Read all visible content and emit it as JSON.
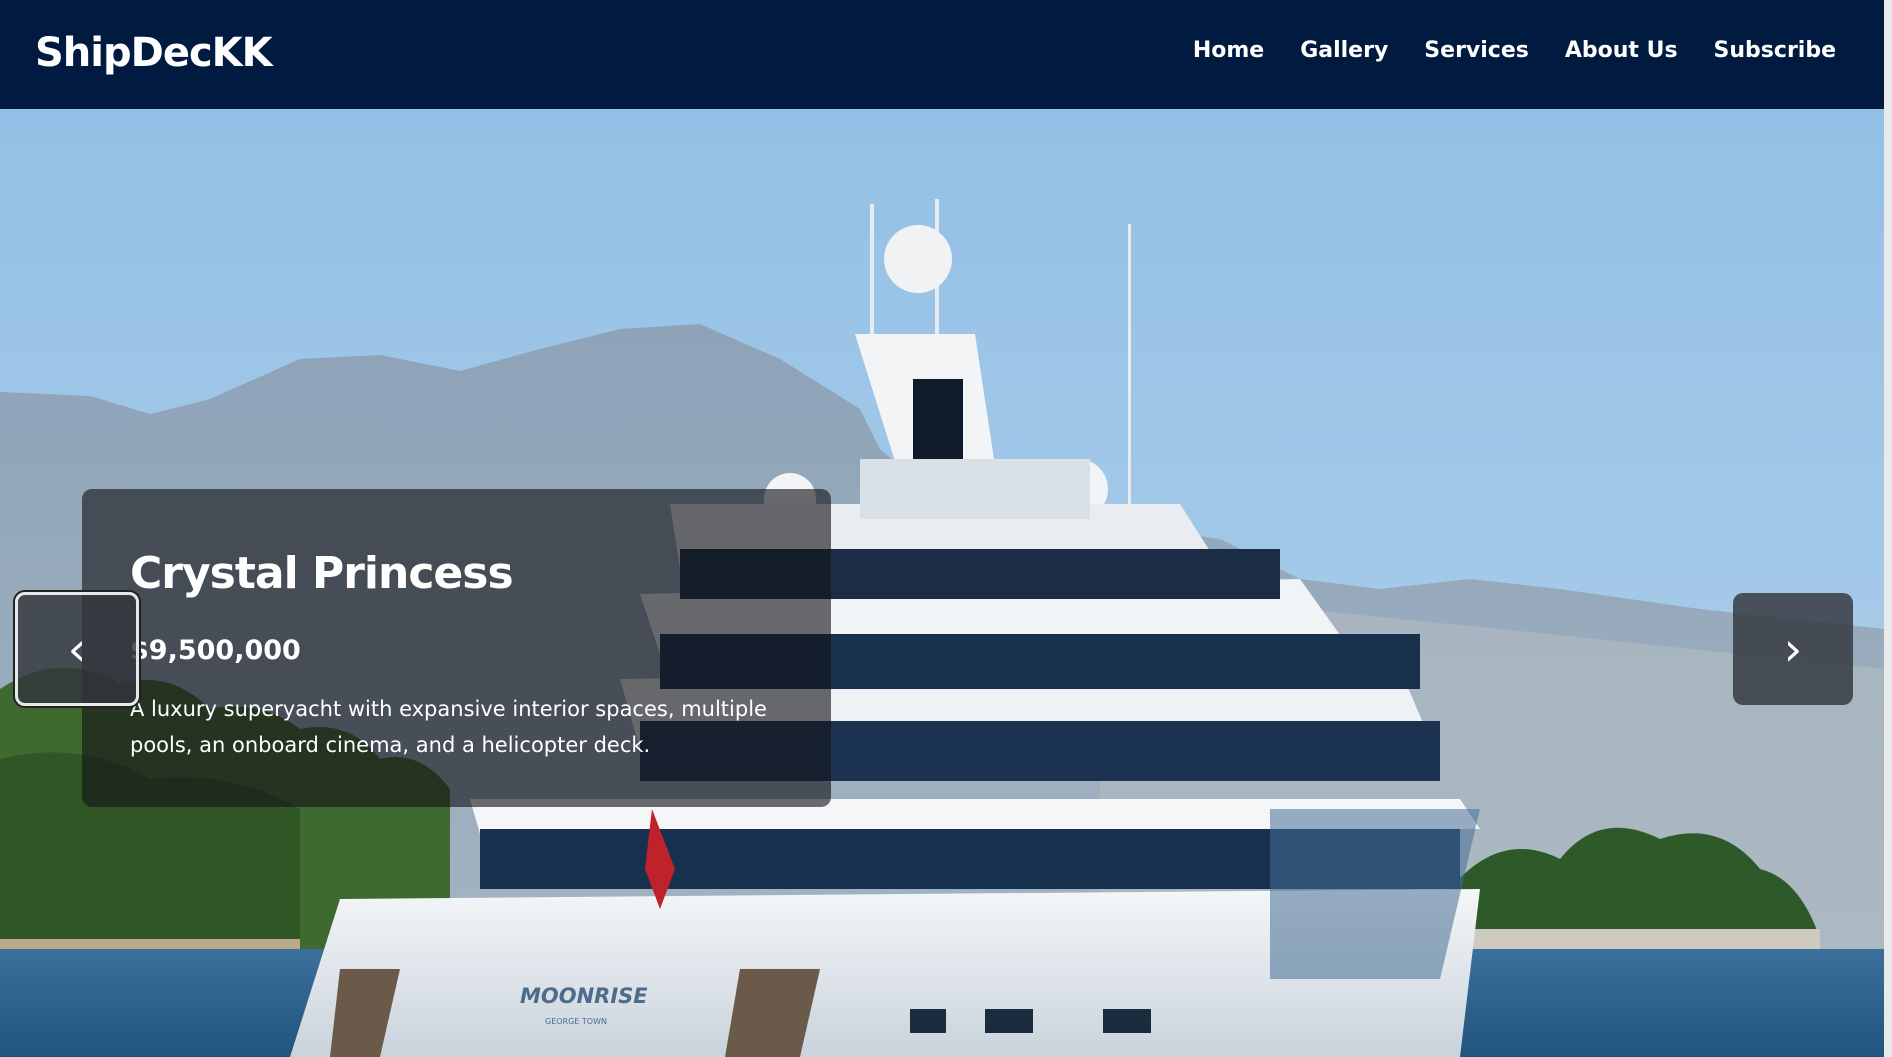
{
  "brand": "ShipDecKK",
  "nav": [
    "Home",
    "Gallery",
    "Services",
    "About Us",
    "Subscribe"
  ],
  "slide": {
    "name": "Crystal Princess",
    "price": "$9,500,000",
    "description": "A luxury superyacht with expansive interior spaces, multiple pools, an onboard cinema, and a helicopter deck."
  },
  "yacht_hull_text": "MOONRISE",
  "yacht_hull_subtext": "GEORGE TOWN",
  "arrows": {
    "prev_icon": "chevron-left-icon",
    "next_icon": "chevron-right-icon",
    "prev_glyph": "‹",
    "next_glyph": "›"
  },
  "colors": {
    "navbar": "#011b40",
    "sky": "#9cc4e6",
    "sea": "#2a5f8f"
  }
}
